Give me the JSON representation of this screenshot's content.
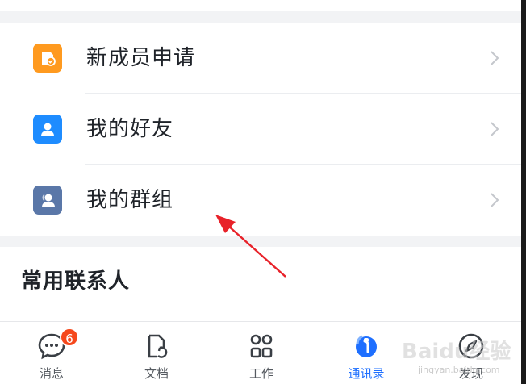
{
  "menu": {
    "items": [
      {
        "label": "新成员申请",
        "icon": "new-member-icon",
        "color": "#ff9a1f"
      },
      {
        "label": "我的好友",
        "icon": "friend-icon",
        "color": "#1e8cff"
      },
      {
        "label": "我的群组",
        "icon": "group-icon",
        "color": "#5a77a8"
      }
    ]
  },
  "section": {
    "title": "常用联系人"
  },
  "tabbar": {
    "tabs": [
      {
        "label": "消息",
        "icon": "message-icon",
        "badge": "6"
      },
      {
        "label": "文档",
        "icon": "document-icon"
      },
      {
        "label": "工作",
        "icon": "workbench-icon"
      },
      {
        "label": "通讯录",
        "icon": "contacts-icon",
        "active": true
      },
      {
        "label": "发现",
        "icon": "discover-icon"
      }
    ]
  },
  "watermark": {
    "text": "Baidu经验",
    "sub": "jingyan.baidu.com"
  },
  "colors": {
    "accent": "#1e6fff",
    "badge": "#f5481c",
    "arrow": "#e8222a"
  }
}
